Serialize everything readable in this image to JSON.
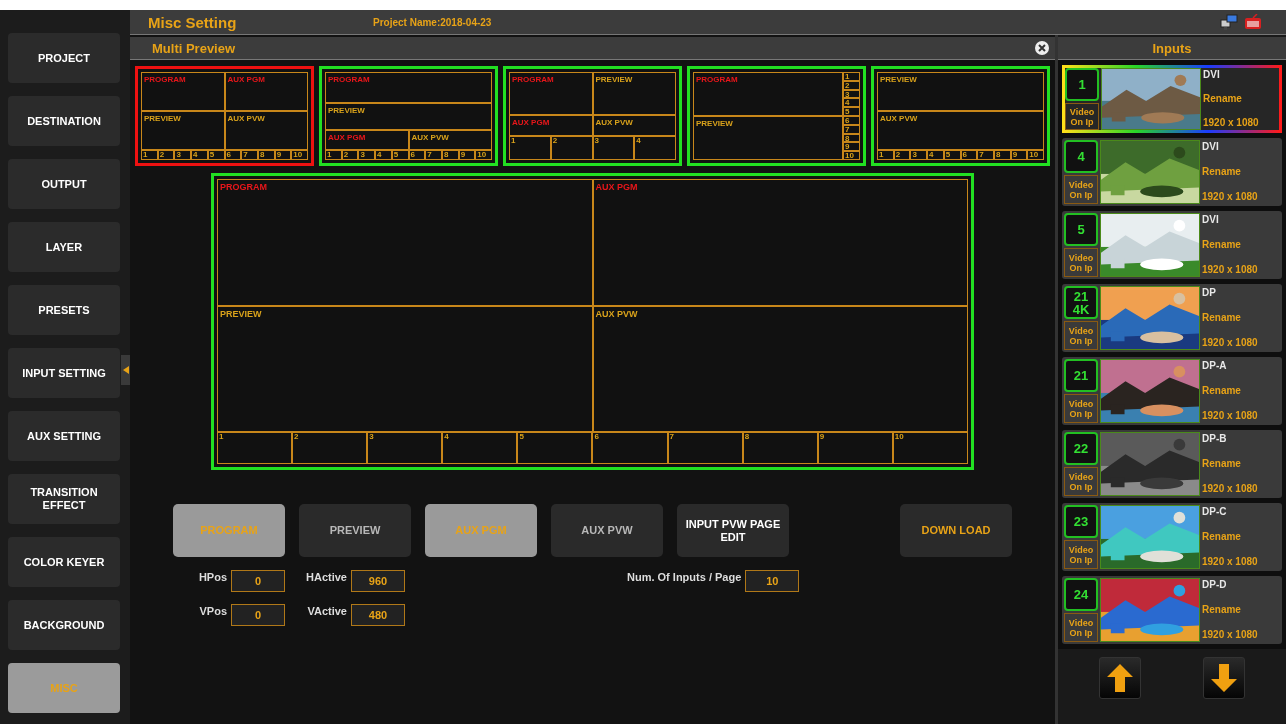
{
  "header": {
    "title": "Misc Setting",
    "project": "Project Name:2018-04-23"
  },
  "sidebar": {
    "items": [
      {
        "label": "PROJECT",
        "selected": false
      },
      {
        "label": "DESTINATION",
        "selected": false
      },
      {
        "label": "OUTPUT",
        "selected": false
      },
      {
        "label": "LAYER",
        "selected": false
      },
      {
        "label": "PRESETS",
        "selected": false
      },
      {
        "label": "INPUT SETTING",
        "selected": false
      },
      {
        "label": "AUX SETTING",
        "selected": false
      },
      {
        "label": "TRANSITION EFFECT",
        "selected": false
      },
      {
        "label": "COLOR KEYER",
        "selected": false
      },
      {
        "label": "BACKGROUND",
        "selected": false
      },
      {
        "label": "MISC",
        "selected": true
      }
    ]
  },
  "preview": {
    "title": "Multi Preview",
    "layouts": [
      {
        "kind": "quad",
        "selected": true,
        "regions": [
          {
            "label": "PROGRAM",
            "color": "#e8161a"
          },
          {
            "label": "AUX PGM",
            "color": "#e8161a"
          },
          {
            "label": "PREVIEW",
            "color": "#d9a21b"
          },
          {
            "label": "AUX PVW",
            "color": "#d9a21b"
          }
        ],
        "numbers": [
          "1",
          "2",
          "3",
          "4",
          "5",
          "6",
          "7",
          "8",
          "9",
          "10"
        ]
      },
      {
        "kind": "stack",
        "selected": false,
        "regions": [
          {
            "label": "PROGRAM",
            "color": "#e8161a"
          },
          {
            "label": "PREVIEW",
            "color": "#d9a21b"
          },
          {
            "label": "AUX PGM",
            "color": "#e8161a"
          },
          {
            "label": "AUX PVW",
            "color": "#d9a21b"
          }
        ],
        "numbers": [
          "1",
          "2",
          "3",
          "4",
          "5",
          "6",
          "7",
          "8",
          "9",
          "10"
        ]
      },
      {
        "kind": "grid4",
        "selected": false,
        "regions": [
          {
            "label": "PROGRAM",
            "color": "#e8161a"
          },
          {
            "label": "PREVIEW",
            "color": "#d9a21b"
          },
          {
            "label": "AUX PGM",
            "color": "#e8161a"
          },
          {
            "label": "AUX PVW",
            "color": "#d9a21b"
          }
        ],
        "numbers": [
          "1",
          "2",
          "3",
          "4"
        ]
      },
      {
        "kind": "side",
        "selected": false,
        "regions": [
          {
            "label": "PROGRAM",
            "color": "#e8161a"
          },
          {
            "label": "PREVIEW",
            "color": "#d9a21b"
          }
        ],
        "numbers": [
          "1",
          "2",
          "3",
          "4",
          "5",
          "6",
          "7",
          "8",
          "9",
          "10"
        ]
      },
      {
        "kind": "pvw",
        "selected": false,
        "regions": [
          {
            "label": "PREVIEW",
            "color": "#d9a21b"
          },
          {
            "label": "AUX PVW",
            "color": "#d9a21b"
          }
        ],
        "numbers": [
          "1",
          "2",
          "3",
          "4",
          "5",
          "6",
          "7",
          "8",
          "9",
          "10"
        ]
      }
    ],
    "main": {
      "kind": "quad",
      "selected": false,
      "regions": [
        {
          "label": "PROGRAM",
          "color": "#e8161a"
        },
        {
          "label": "AUX PGM",
          "color": "#e8161a"
        },
        {
          "label": "PREVIEW",
          "color": "#d9a21b"
        },
        {
          "label": "AUX PVW",
          "color": "#d9a21b"
        }
      ],
      "numbers": [
        "1",
        "2",
        "3",
        "4",
        "5",
        "6",
        "7",
        "8",
        "9",
        "10"
      ]
    }
  },
  "buttons": [
    {
      "kind": "toggle",
      "label": "PROGRAM",
      "selected": true
    },
    {
      "kind": "toggle",
      "label": "PREVIEW",
      "selected": false
    },
    {
      "kind": "toggle",
      "label": "AUX PGM",
      "selected": true
    },
    {
      "kind": "toggle",
      "label": "AUX PVW",
      "selected": false
    },
    {
      "kind": "page",
      "label": "INPUT PVW PAGE EDIT"
    },
    {
      "kind": "download",
      "label": "DOWN LOAD"
    }
  ],
  "position_fields": [
    {
      "label": "HPos",
      "value": "0"
    },
    {
      "label": "HActive",
      "value": "960"
    },
    {
      "label": "VPos",
      "value": "0"
    },
    {
      "label": "VActive",
      "value": "480"
    }
  ],
  "page_field": {
    "label": "Num. Of Inputs / Page",
    "value": "10"
  },
  "inputs": {
    "title": "Inputs",
    "items": [
      {
        "number": "1",
        "badge": "Video On Ip",
        "type": "DVI",
        "rename": "Rename",
        "resolution": "1920 x 1080",
        "selected": true
      },
      {
        "number": "4",
        "badge": "Video On Ip",
        "type": "DVI",
        "rename": "Rename",
        "resolution": "1920 x 1080",
        "selected": false
      },
      {
        "number": "5",
        "badge": "Video On Ip",
        "type": "DVI",
        "rename": "Rename",
        "resolution": "1920 x 1080",
        "selected": false
      },
      {
        "number": "21",
        "tag": "4K",
        "badge": "Video On Ip",
        "type": "DP",
        "rename": "Rename",
        "resolution": "1920 x 1080",
        "selected": false
      },
      {
        "number": "21",
        "badge": "Video On Ip",
        "type": "DP-A",
        "rename": "Rename",
        "resolution": "1920 x 1080",
        "selected": false
      },
      {
        "number": "22",
        "badge": "Video On Ip",
        "type": "DP-B",
        "rename": "Rename",
        "resolution": "1920 x 1080",
        "selected": false
      },
      {
        "number": "23",
        "badge": "Video On Ip",
        "type": "DP-C",
        "rename": "Rename",
        "resolution": "1920 x 1080",
        "selected": false
      },
      {
        "number": "24",
        "badge": "Video On Ip",
        "type": "DP-D",
        "rename": "Rename",
        "resolution": "1920 x 1080",
        "selected": false
      }
    ]
  }
}
